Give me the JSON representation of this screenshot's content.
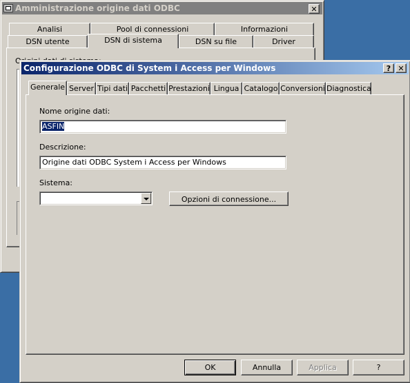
{
  "back_window": {
    "title": "Amministrazione origine dati ODBC",
    "close_label": "✕",
    "tabs_row1": [
      "Analisi",
      "Pool di connessioni",
      "Informazioni"
    ],
    "tabs_row2": [
      "DSN utente",
      "DSN di sistema",
      "DSN su file",
      "Driver"
    ],
    "selected_tab": "DSN di sistema",
    "panel_caption": "Origini dati di sistema:"
  },
  "dialog": {
    "title": "Configurazione ODBC di System i Access per Windows",
    "help_label": "?",
    "close_label": "✕",
    "tabs": [
      "Generale",
      "Server",
      "Tipi dati",
      "Pacchetti",
      "Prestazioni",
      "Lingua",
      "Catalogo",
      "Conversioni",
      "Diagnostica"
    ],
    "selected_tab": "Generale",
    "data_source_label": "Nome origine dati:",
    "data_source_value": "ASFIN",
    "description_label": "Descrizione:",
    "description_value": "Origine dati ODBC System i Access per Windows",
    "system_label": "Sistema:",
    "system_value": "",
    "connection_options_label": "Opzioni di connessione...",
    "buttons": {
      "ok": "OK",
      "cancel": "Annulla",
      "apply": "Applica",
      "help": "?"
    }
  }
}
